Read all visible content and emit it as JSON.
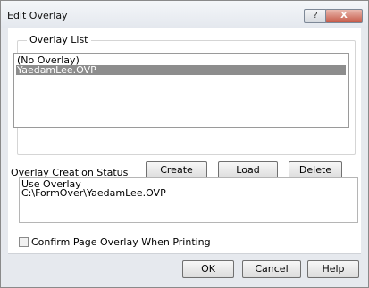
{
  "window": {
    "title": "Edit Overlay",
    "help_glyph": "?",
    "close_glyph": "X"
  },
  "overlay_list": {
    "legend": "Overlay List",
    "items": [
      "(No Overlay)",
      "YaedamLee.OVP"
    ],
    "selected_index": 1,
    "buttons": {
      "create": "Create",
      "load": "Load",
      "delete": "Delete"
    }
  },
  "status": {
    "label": "Overlay Creation Status",
    "line1": "Use Overlay",
    "line2": "C:\\FormOver\\YaedamLee.OVP"
  },
  "confirm_checkbox": {
    "label": "Confirm Page Overlay When Printing",
    "checked": false
  },
  "footer": {
    "ok": "OK",
    "cancel": "Cancel",
    "help": "Help"
  },
  "colors": {
    "selection": "#8d8d8d",
    "close_button": "#c65a48"
  }
}
